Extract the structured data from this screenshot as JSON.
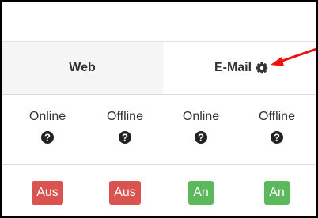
{
  "header": {
    "web_label": "Web",
    "email_label": "E-Mail",
    "email_settings_icon": "gear-icon"
  },
  "columns": [
    {
      "label": "Online",
      "help_icon": "question-circle-icon",
      "button": {
        "label": "Aus",
        "state": "off",
        "color": "#d9534f"
      }
    },
    {
      "label": "Offline",
      "help_icon": "question-circle-icon",
      "button": {
        "label": "Aus",
        "state": "off",
        "color": "#d9534f"
      }
    },
    {
      "label": "Online",
      "help_icon": "question-circle-icon",
      "button": {
        "label": "An",
        "state": "on",
        "color": "#5cb85c"
      }
    },
    {
      "label": "Offline",
      "help_icon": "question-circle-icon",
      "button": {
        "label": "An",
        "state": "on",
        "color": "#5cb85c"
      }
    }
  ],
  "annotation": {
    "arrow_color": "#ee1111",
    "points_to": "email-settings-gear"
  }
}
